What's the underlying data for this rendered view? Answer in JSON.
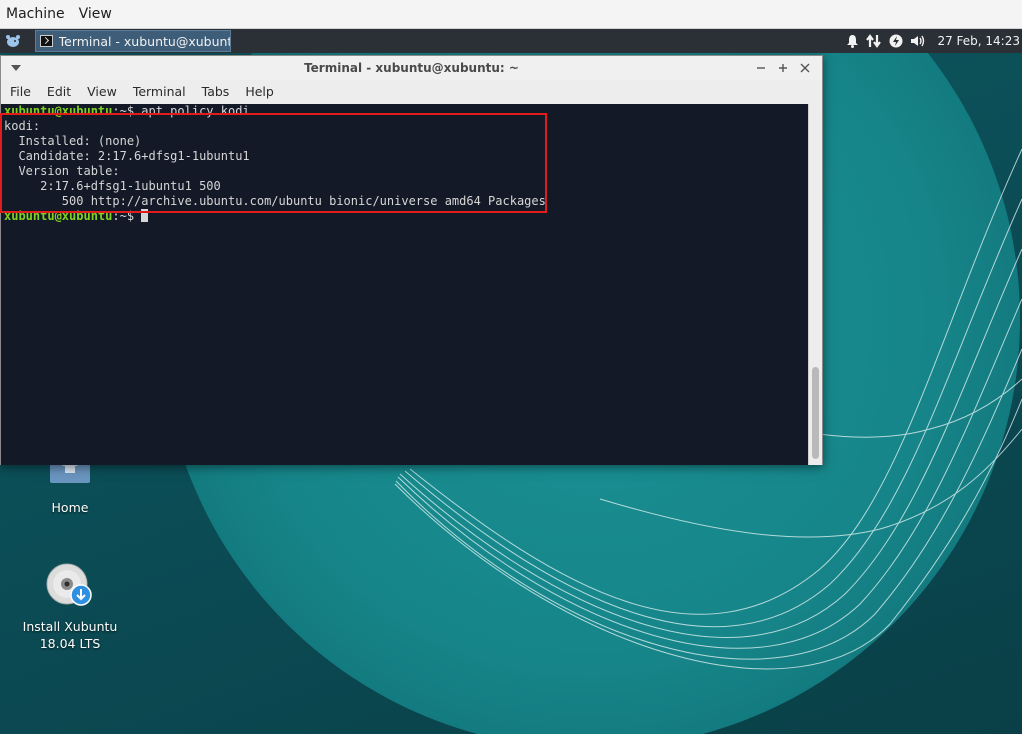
{
  "host_menu": [
    "Machine",
    "View"
  ],
  "panel": {
    "task_label": "Terminal - xubuntu@xubuntu...",
    "clock": "27 Feb, 14:23"
  },
  "desktop_icons": {
    "home_label": "Home",
    "install_label_line1": "Install Xubuntu",
    "install_label_line2": "18.04 LTS"
  },
  "window": {
    "title": "Terminal - xubuntu@xubuntu: ~",
    "menu": [
      "File",
      "Edit",
      "View",
      "Terminal",
      "Tabs",
      "Help"
    ]
  },
  "terminal": {
    "prompt_user": "xubuntu@xubuntu",
    "prompt_sep": ":~$ ",
    "command": "apt policy kodi",
    "output": [
      "kodi:",
      "  Installed: (none)",
      "  Candidate: 2:17.6+dfsg1-1ubuntu1",
      "  Version table:",
      "     2:17.6+dfsg1-1ubuntu1 500",
      "        500 http://archive.ubuntu.com/ubuntu bionic/universe amd64 Packages"
    ]
  },
  "colors": {
    "prompt": "#7ed321",
    "terminal_bg": "#131926",
    "highlight": "#e21b1b"
  }
}
